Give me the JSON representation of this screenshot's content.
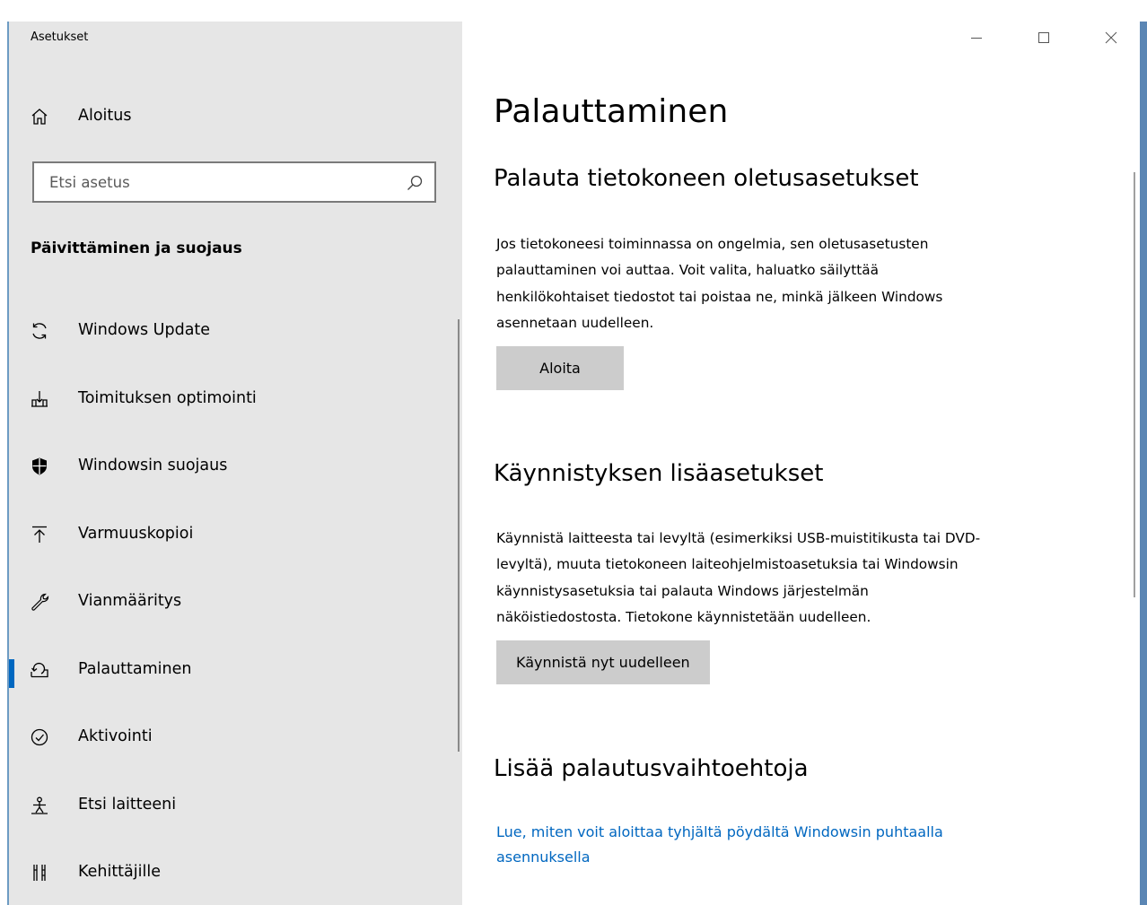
{
  "window": {
    "app_title": "Asetukset"
  },
  "sidebar": {
    "home_label": "Aloitus",
    "search_placeholder": "Etsi asetus",
    "section_heading": "Päivittäminen ja suojaus",
    "active_index": 6,
    "items": [
      {
        "label": "Windows Update",
        "icon": "refresh-icon"
      },
      {
        "label": "Toimituksen optimointi",
        "icon": "delivery-optimization-icon"
      },
      {
        "label": "Windowsin suojaus",
        "icon": "shield-icon"
      },
      {
        "label": "Varmuuskopioi",
        "icon": "upload-arrow-icon"
      },
      {
        "label": "Vianmääritys",
        "icon": "wrench-icon"
      },
      {
        "label": "Palauttaminen",
        "icon": "recovery-icon"
      },
      {
        "label": "Aktivointi",
        "icon": "check-circle-icon"
      },
      {
        "label": "Etsi laitteeni",
        "icon": "person-location-icon"
      },
      {
        "label": "Kehittäjille",
        "icon": "developer-tools-icon"
      }
    ]
  },
  "main": {
    "page_title": "Palauttaminen",
    "reset": {
      "title": "Palauta tietokoneen oletusasetukset",
      "lines": [
        "Jos tietokoneesi toiminnassa on ongelmia, sen oletusasetusten",
        "palauttaminen voi auttaa. Voit valita, haluatko säilyttää",
        "henkilökohtaiset tiedostot tai poistaa ne, minkä jälkeen Windows",
        "asennetaan uudelleen."
      ],
      "button": "Aloita"
    },
    "startup": {
      "title": "Käynnistyksen lisäasetukset",
      "lines": [
        "Käynnistä laitteesta tai levyltä (esimerkiksi USB-muistitikusta tai DVD-",
        "levyltä), muuta tietokoneen laiteohjelmistoasetuksia tai Windowsin",
        "käynnistysasetuksia tai palauta Windows järjestelmän",
        "näköistiedostosta. Tietokone käynnistetään uudelleen."
      ],
      "button": "Käynnistä nyt uudelleen"
    },
    "more": {
      "title": "Lisää palautusvaihtoehtoja",
      "link_lines": [
        "Lue, miten voit aloittaa tyhjältä pöydältä Windowsin puhtaalla",
        "asennuksella"
      ]
    }
  },
  "colors": {
    "sidebar_bg": "#e6e6e6",
    "accent": "#0067c0",
    "button_bg": "#cccccc"
  }
}
